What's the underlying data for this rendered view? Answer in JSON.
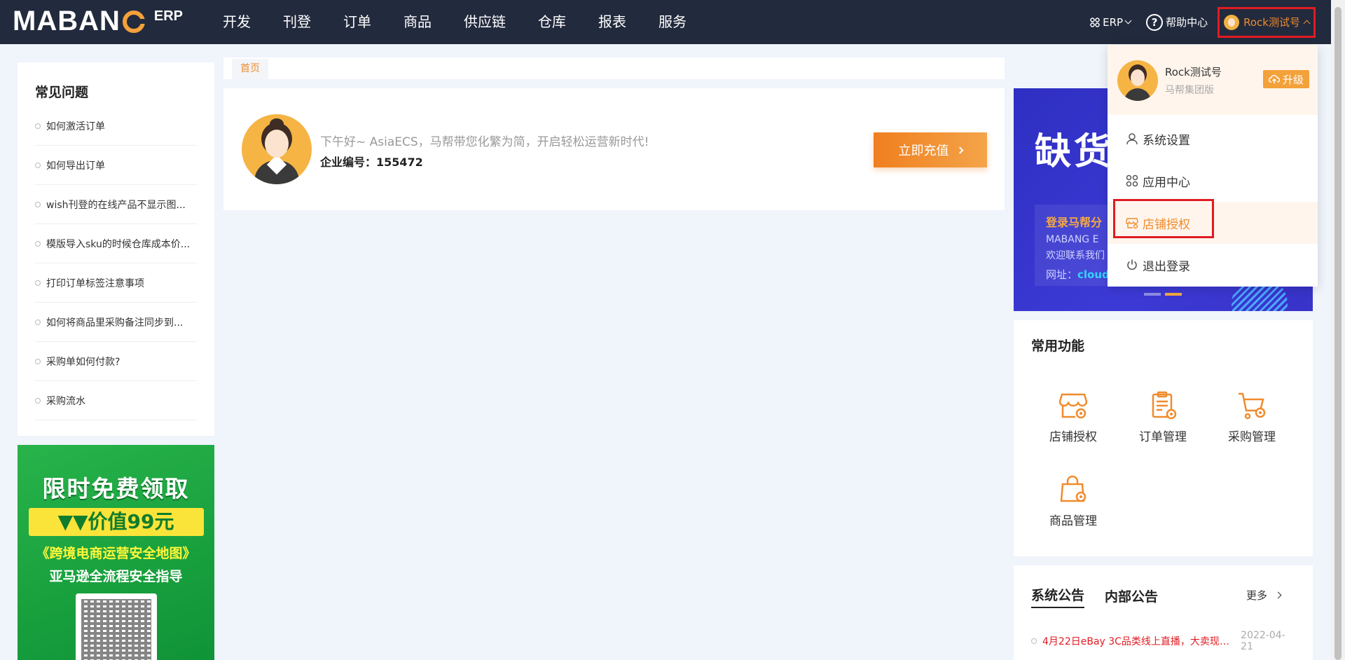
{
  "logo": {
    "main_left": "MABAN",
    "main_right": "",
    "erp": "ERP"
  },
  "nav": {
    "items": [
      "开发",
      "刊登",
      "订单",
      "商品",
      "供应链",
      "仓库",
      "报表",
      "服务"
    ]
  },
  "top_right": {
    "erp_label": "ERP",
    "help_label": "帮助中心",
    "user_label": "Rock测试号"
  },
  "faq": {
    "title": "常见问题",
    "items": [
      "如何激活订单",
      "如何导出订单",
      "wish刊登的在线产品不显示图...",
      "模版导入sku的时候仓库成本价...",
      "打印订单标签注意事项",
      "如何将商品里采购备注同步到...",
      "采购单如何付款?",
      "采购流水"
    ]
  },
  "promo": {
    "line1": "限时免费领取",
    "line2": "▼▼价值99元",
    "line3": "《跨境电商运营安全地图》",
    "line4": "亚马逊全流程安全指导"
  },
  "breadcrumb": {
    "home": "首页"
  },
  "welcome": {
    "greeting": "下午好~ AsiaECS，马帮带您化繁为简，开启轻松运营新时代!",
    "corp_label": "企业编号：",
    "corp_id": "155472",
    "recharge_label": "立即充值"
  },
  "banner": {
    "title": "缺货",
    "line1": "登录马帮分",
    "line2": "MABANG E",
    "line3": "欢迎联系我们",
    "line4_label": "网址：",
    "line4_value": "cloud"
  },
  "common_functions": {
    "title": "常用功能",
    "items": [
      "店铺授权",
      "订单管理",
      "采购管理",
      "商品管理"
    ]
  },
  "notice": {
    "tab_system": "系统公告",
    "tab_internal": "内部公告",
    "more_label": "更多",
    "items": [
      {
        "text": "4月22日eBay 3C品类线上直播，大卖现身...",
        "date": "2022-04-21"
      }
    ]
  },
  "user_dropdown": {
    "name": "Rock测试号",
    "org": "马帮集团版",
    "upgrade_label": "升级",
    "items": [
      "系统设置",
      "应用中心",
      "店铺授权",
      "退出登录"
    ],
    "active_index": 2
  },
  "colors": {
    "nav_bg": "#222a3d",
    "accent_orange": "#f08b2c",
    "highlight_red": "#e11b22",
    "page_bg": "#f0f4fb"
  }
}
